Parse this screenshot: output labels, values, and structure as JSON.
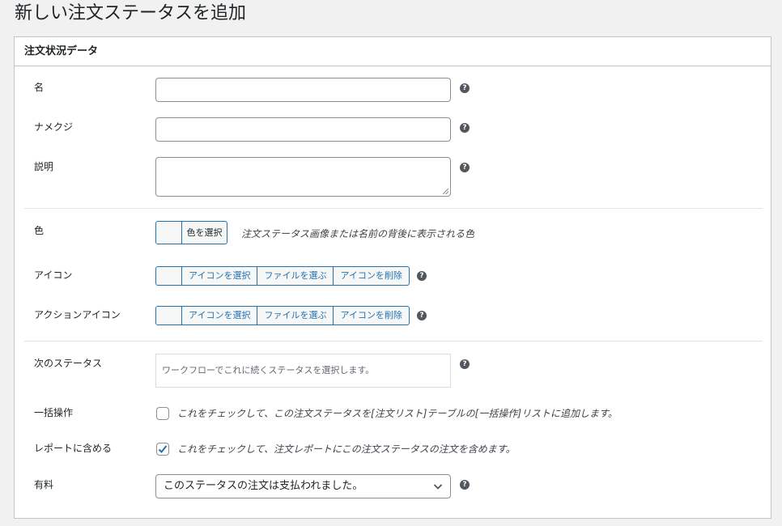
{
  "page": {
    "title": "新しい注文ステータスを追加"
  },
  "box": {
    "title": "注文状況データ"
  },
  "fields": {
    "name": {
      "label": "名",
      "value": ""
    },
    "slug": {
      "label": "ナメクジ",
      "value": ""
    },
    "description": {
      "label": "説明",
      "value": ""
    },
    "color": {
      "label": "色",
      "button_label": "色を選択",
      "description": "注文ステータス画像または名前の背後に表示される色"
    },
    "icon": {
      "label": "アイコン",
      "select_label": "アイコンを選択",
      "file_label": "ファイルを選ぶ",
      "remove_label": "アイコンを削除"
    },
    "action_icon": {
      "label": "アクションアイコン",
      "select_label": "アイコンを選択",
      "file_label": "ファイルを選ぶ",
      "remove_label": "アイコンを削除"
    },
    "next_status": {
      "label": "次のステータス",
      "placeholder": "ワークフローでこれに続くステータスを選択します。"
    },
    "bulk_action": {
      "label": "一括操作",
      "checked": false,
      "text": "これをチェックして、この注文ステータスを[注文リスト]テーブルの[一括操作]リストに追加します。"
    },
    "include_reports": {
      "label": "レポートに含める",
      "checked": true,
      "text": "これをチェックして、注文レポートにこの注文ステータスの注文を含めます。"
    },
    "paid": {
      "label": "有料",
      "selected": "このステータスの注文は支払われました。"
    }
  },
  "icons": {
    "help": "help-icon",
    "check": "check-icon",
    "dropdown": "chevron-down-icon"
  },
  "colors": {
    "accent": "#2271b1",
    "border": "#8c8f94",
    "background": "#f1f1f1"
  }
}
